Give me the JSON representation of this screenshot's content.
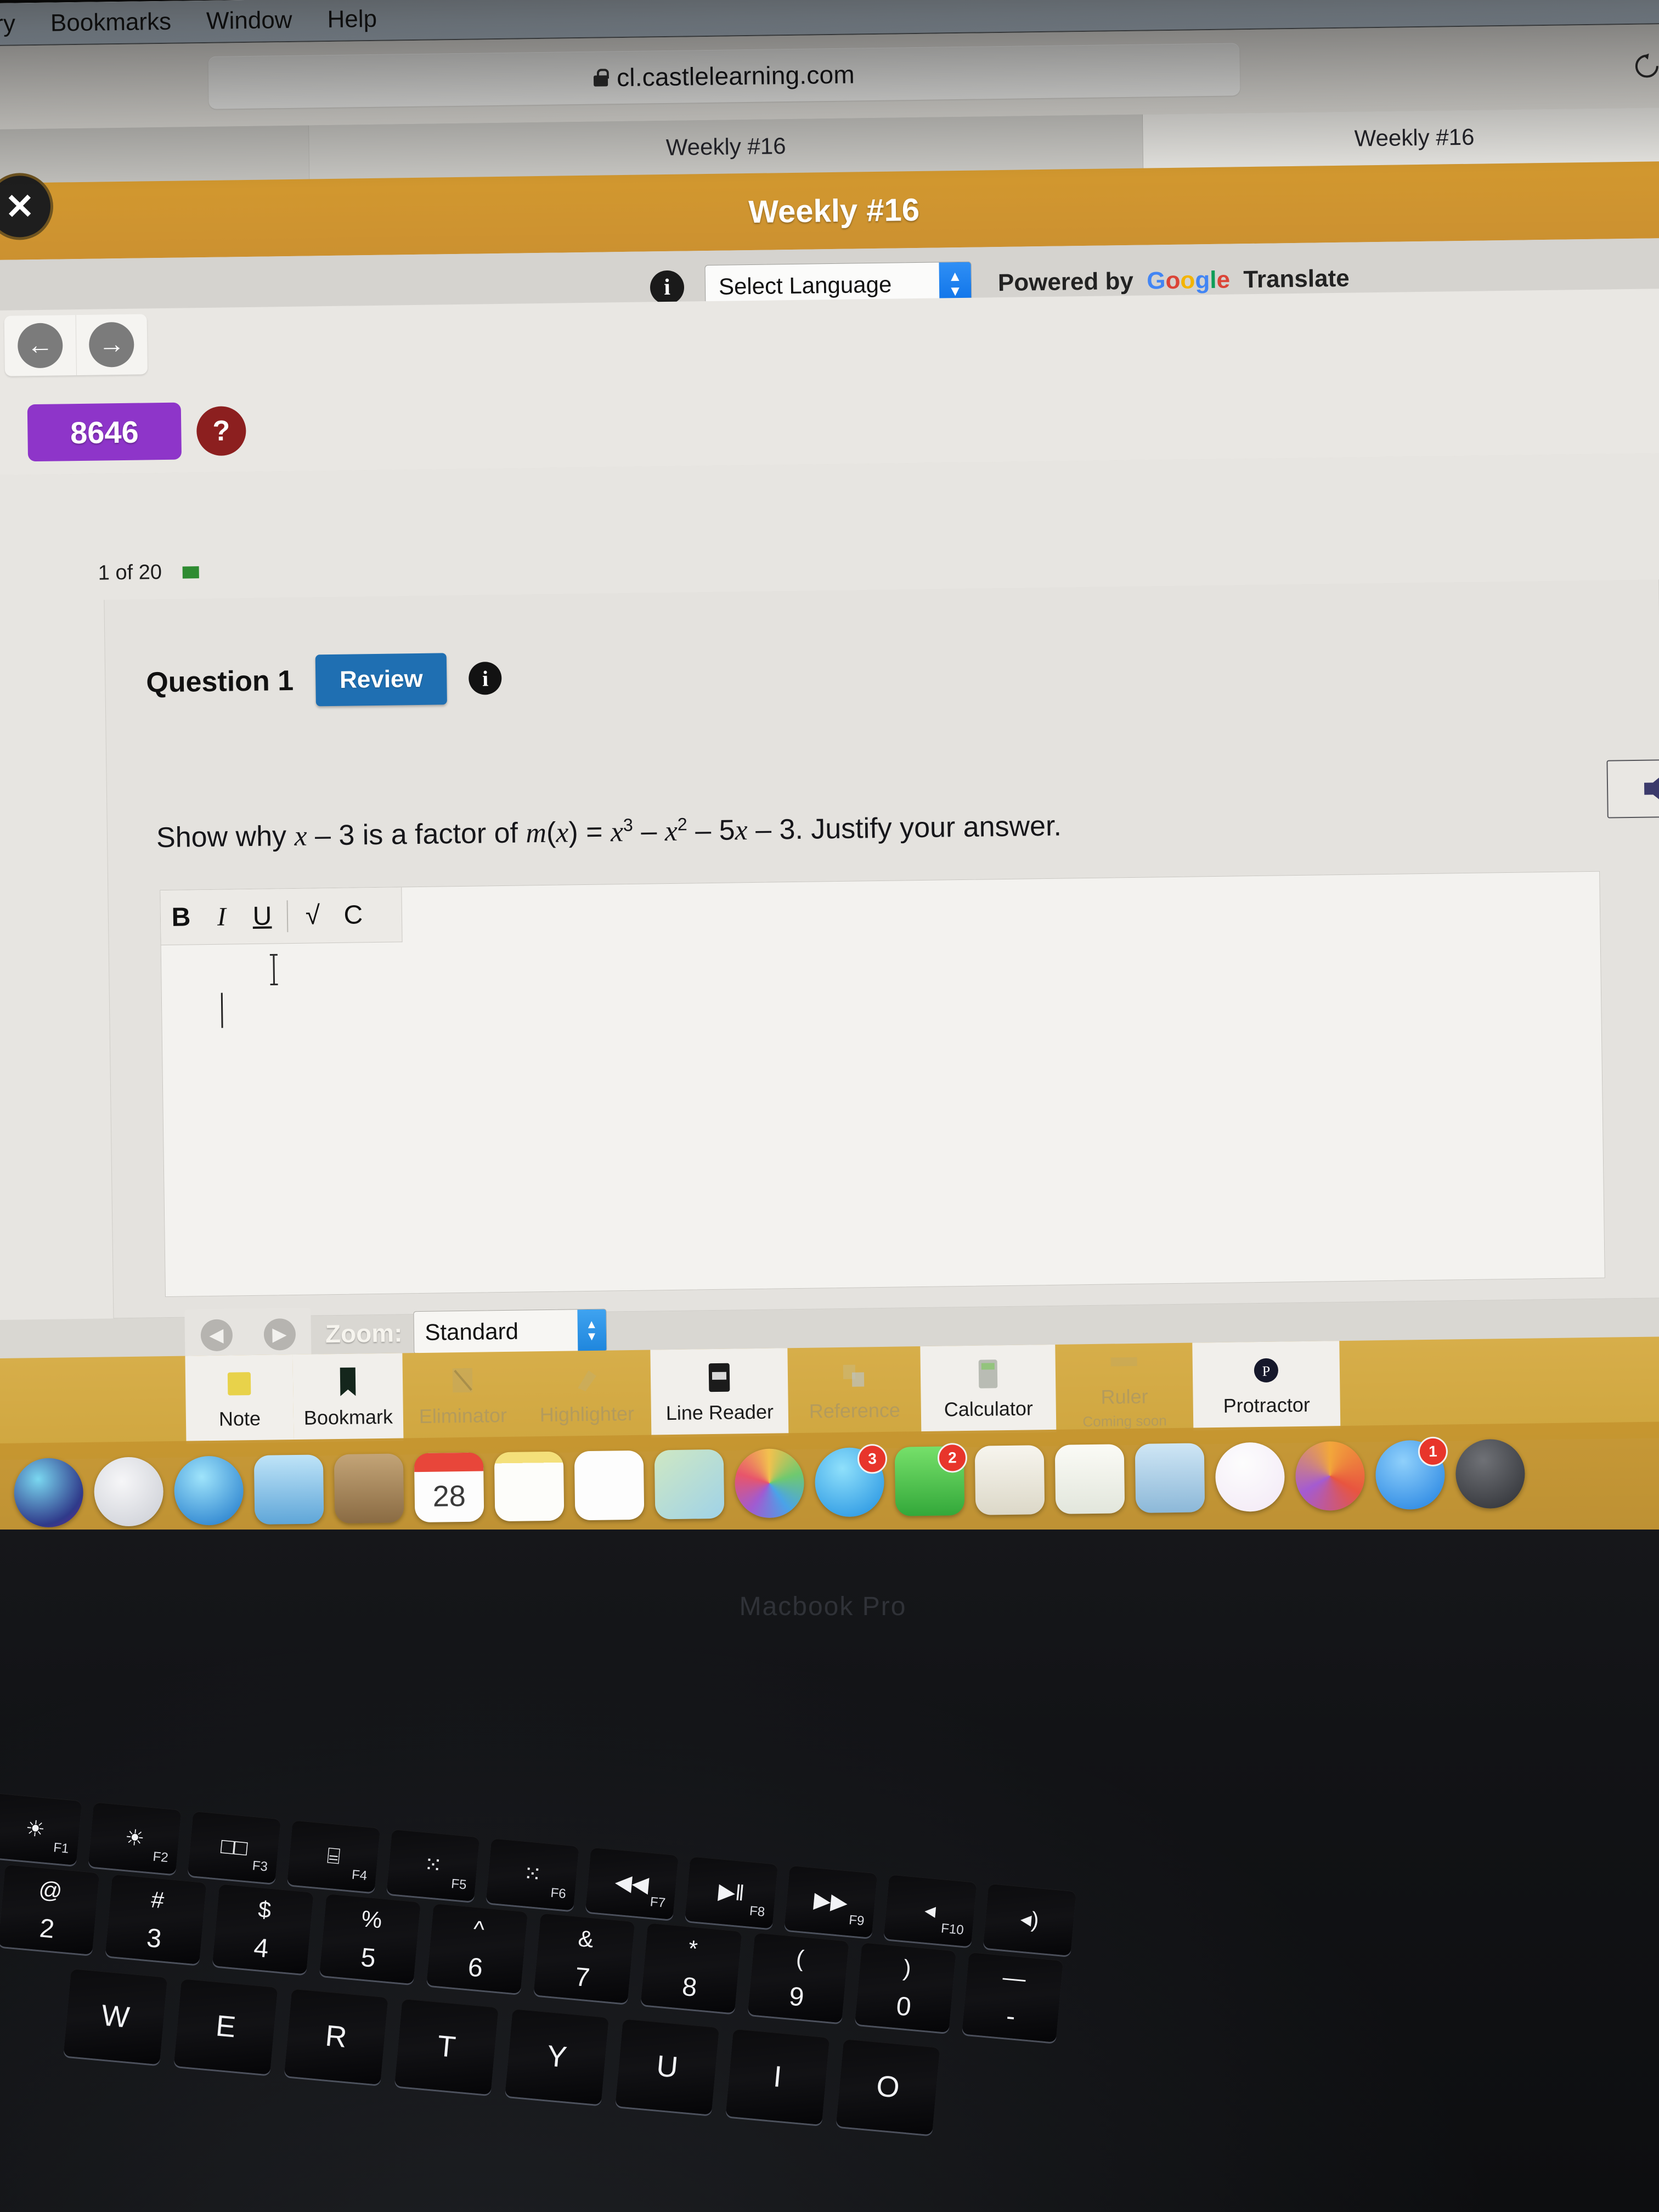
{
  "menubar": {
    "items": [
      "story",
      "Bookmarks",
      "Window",
      "Help"
    ]
  },
  "browser": {
    "url": "cl.castlelearning.com",
    "lock_icon": "lock-icon",
    "reload_icon": "reload-icon",
    "tabs": [
      {
        "label": ""
      },
      {
        "label": "Weekly #16"
      },
      {
        "label": "Weekly #16"
      }
    ]
  },
  "app_header": {
    "title": "Weekly #16",
    "close_label": "✕"
  },
  "translate": {
    "info_icon": "info-icon",
    "select_value": "Select Language",
    "powered_prefix": "Powered by",
    "google": [
      "G",
      "o",
      "o",
      "g",
      "l",
      "e"
    ],
    "translate_word": "Translate"
  },
  "nav": {
    "back_icon": "←",
    "forward_icon": "→",
    "score": "8646",
    "help": "?"
  },
  "question": {
    "progress_label": "1 of 20",
    "number_label": "Question 1",
    "review_label": "Review",
    "info_icon": "info-icon",
    "prompt_parts": {
      "p1": "Show why ",
      "x1": "x",
      "p2": " – 3 is a factor of ",
      "m": "m",
      "p3": "(",
      "x2": "x",
      "p4": ") = ",
      "x3": "x",
      "sup3": "3",
      "p5": " – ",
      "x4": "x",
      "sup2": "2",
      "p6": " – 5",
      "x5": "x",
      "p7": " – 3. Justify your answer."
    }
  },
  "editor": {
    "buttons": [
      "B",
      "I",
      "U",
      "√",
      "C"
    ],
    "value": ""
  },
  "zoom_bar": {
    "prev_icon": "◀",
    "next_icon": "▶",
    "label": "Zoom:",
    "value": "Standard"
  },
  "tools": [
    {
      "name": "Note",
      "icon": "sticky-note-icon",
      "dim": false,
      "sub": ""
    },
    {
      "name": "Bookmark",
      "icon": "bookmark-icon",
      "dim": false,
      "sub": ""
    },
    {
      "name": "Eliminator",
      "icon": "eliminator-icon",
      "dim": true,
      "sub": ""
    },
    {
      "name": "Highlighter",
      "icon": "highlighter-icon",
      "dim": true,
      "sub": ""
    },
    {
      "name": "Line Reader",
      "icon": "line-reader-icon",
      "dim": false,
      "sub": ""
    },
    {
      "name": "Reference",
      "icon": "reference-icon",
      "dim": true,
      "sub": ""
    },
    {
      "name": "Calculator",
      "icon": "calculator-icon",
      "dim": false,
      "sub": ""
    },
    {
      "name": "Ruler",
      "icon": "ruler-icon",
      "dim": true,
      "sub": "Coming soon"
    },
    {
      "name": "Protractor",
      "icon": "protractor-icon",
      "dim": false,
      "sub": ""
    }
  ],
  "speaker": {
    "icon": "speaker-icon"
  },
  "dock": [
    {
      "name": "finder",
      "badge": ""
    },
    {
      "name": "launchpad",
      "badge": ""
    },
    {
      "name": "safari",
      "badge": ""
    },
    {
      "name": "mail",
      "badge": ""
    },
    {
      "name": "contacts",
      "badge": ""
    },
    {
      "name": "calendar",
      "badge": "28"
    },
    {
      "name": "notes",
      "badge": ""
    },
    {
      "name": "reminders",
      "badge": ""
    },
    {
      "name": "maps",
      "badge": ""
    },
    {
      "name": "photos",
      "badge": ""
    },
    {
      "name": "messages",
      "badge": "3"
    },
    {
      "name": "facetime",
      "badge": "2"
    },
    {
      "name": "pages",
      "badge": ""
    },
    {
      "name": "numbers",
      "badge": ""
    },
    {
      "name": "keynote",
      "badge": ""
    },
    {
      "name": "itunes",
      "badge": ""
    },
    {
      "name": "ibooks",
      "badge": ""
    },
    {
      "name": "appstore",
      "badge": "1"
    },
    {
      "name": "settings",
      "badge": ""
    }
  ],
  "keyboard": {
    "function_row": [
      {
        "glyph": "☀",
        "fn": "F1"
      },
      {
        "glyph": "☀",
        "fn": "F2"
      },
      {
        "glyph": "□□",
        "fn": "F3"
      },
      {
        "glyph": "⌸",
        "fn": "F4"
      },
      {
        "glyph": "⁙",
        "fn": "F5"
      },
      {
        "glyph": "⁙",
        "fn": "F6"
      },
      {
        "glyph": "◀◀",
        "fn": "F7"
      },
      {
        "glyph": "▶‖",
        "fn": "F8"
      },
      {
        "glyph": "▶▶",
        "fn": "F9"
      },
      {
        "glyph": "◂",
        "fn": "F10"
      },
      {
        "glyph": "◂)",
        "fn": ""
      }
    ],
    "number_row": [
      {
        "up": "@",
        "dn": "2"
      },
      {
        "up": "#",
        "dn": "3"
      },
      {
        "up": "$",
        "dn": "4"
      },
      {
        "up": "%",
        "dn": "5"
      },
      {
        "up": "^",
        "dn": "6"
      },
      {
        "up": "&",
        "dn": "7"
      },
      {
        "up": "*",
        "dn": "8"
      },
      {
        "up": "(",
        "dn": "9"
      },
      {
        "up": ")",
        "dn": "0"
      },
      {
        "up": "—",
        "dn": "-"
      }
    ],
    "letter_row": [
      {
        "dn": "W"
      },
      {
        "dn": "E"
      },
      {
        "dn": "R"
      },
      {
        "dn": "T"
      },
      {
        "dn": "Y"
      },
      {
        "dn": "U"
      },
      {
        "dn": "I"
      },
      {
        "dn": "O"
      }
    ]
  },
  "colors": {
    "castle_orange": "#cc9130",
    "review_blue": "#1f6fb2",
    "score_purple": "#8e35c9",
    "help_red": "#8c1f1f",
    "tool_gold": "#cfa63f",
    "progress_green": "#2e8b31"
  }
}
